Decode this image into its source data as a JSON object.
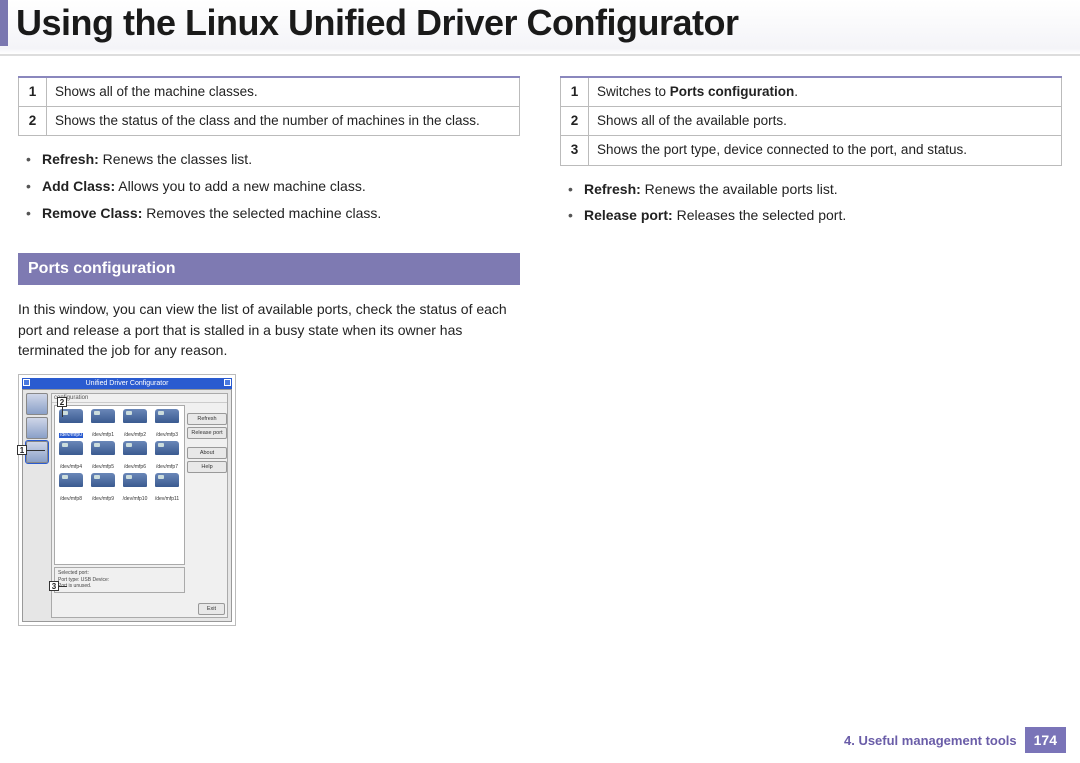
{
  "title": "Using the Linux Unified Driver Configurator",
  "left": {
    "table": [
      {
        "n": "1",
        "text": "Shows all of the machine classes."
      },
      {
        "n": "2",
        "text": "Shows the status of the class and the number of machines in the class."
      }
    ],
    "actions": [
      {
        "b": "Refresh:",
        "t": " Renews the classes list."
      },
      {
        "b": "Add Class:",
        "t": " Allows you to add a new machine class."
      },
      {
        "b": "Remove Class:",
        "t": " Removes the selected machine class."
      }
    ],
    "section": "Ports configuration",
    "desc": "In this window, you can view the list of available ports, check the status of each port and release a port that is stalled in a busy state when its owner has terminated the job for any reason."
  },
  "right": {
    "table": [
      {
        "n": "1",
        "pre": "Switches to ",
        "b": "Ports configuration",
        "post": "."
      },
      {
        "n": "2",
        "text": "Shows all of the available ports."
      },
      {
        "n": "3",
        "text": "Shows the port type, device connected to the port, and status."
      }
    ],
    "actions": [
      {
        "b": "Refresh:",
        "t": " Renews the available ports list."
      },
      {
        "b": "Release port:",
        "t": " Releases the selected port."
      }
    ]
  },
  "shot": {
    "title": "Unified Driver Configurator",
    "cfg": "configuration",
    "btns": [
      "Refresh",
      "Release port",
      "About",
      "Help"
    ],
    "ports": [
      "/dev/mfp0",
      "/dev/mfp1",
      "/dev/mfp2",
      "/dev/mfp3",
      "/dev/mfp4",
      "/dev/mfp5",
      "/dev/mfp6",
      "/dev/mfp7",
      "/dev/mfp8",
      "/dev/mfp9",
      "/dev/mfp10",
      "/dev/mfp11"
    ],
    "sel_hdr": "Selected port:",
    "sel_l1": "Port type: USB   Device:",
    "sel_l2": "Port is unused.",
    "exit": "Exit",
    "call1": "1",
    "call2": "2",
    "call3": "3"
  },
  "footer": {
    "chapter": "4.  Useful management tools",
    "page": "174"
  }
}
